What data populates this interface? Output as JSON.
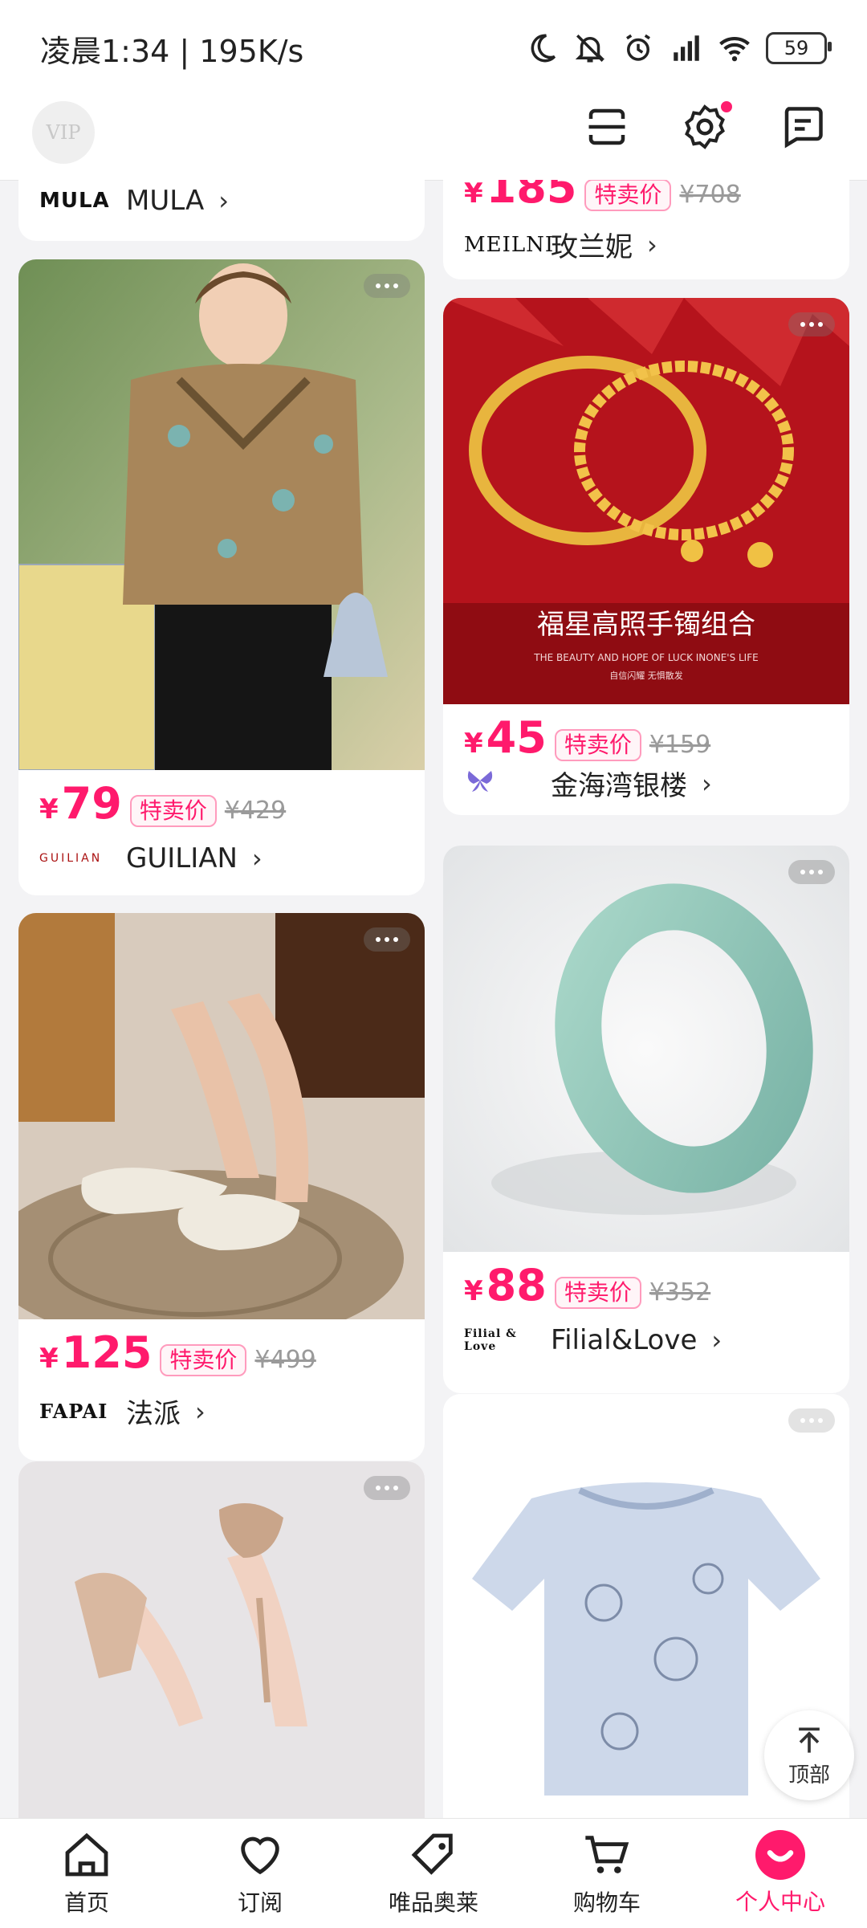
{
  "status": {
    "time": "凌晨1:34 | 195K/s",
    "battery": "59",
    "icons": [
      "moon-icon",
      "mute-bell-icon",
      "alarm-icon",
      "signal-icon",
      "wifi-icon",
      "battery-icon"
    ]
  },
  "topbar": {
    "logo_text": "VIP",
    "icons": [
      "scan-icon",
      "settings-icon",
      "message-icon"
    ]
  },
  "products": {
    "c0": {
      "brand_logo": "MULA",
      "brand": "MULA"
    },
    "c1": {
      "price": "185",
      "tag": "特卖价",
      "orig": "¥708",
      "brand_logo": "MEILNI",
      "brand": "玫兰妮"
    },
    "c2": {
      "price": "79",
      "tag": "特卖价",
      "orig": "¥429",
      "brand_logo": "GUILIAN",
      "brand": "GUILIAN"
    },
    "c3": {
      "price": "45",
      "tag": "特卖价",
      "orig": "¥159",
      "brand": "金海湾银楼",
      "banner_title": "福星高照手镯组合",
      "banner_sub": "THE BEAUTY AND HOPE OF LUCK INONE'S LIFE",
      "banner_sub2": "自信闪耀 无惧散发"
    },
    "c4": {
      "price": "125",
      "tag": "特卖价",
      "orig": "¥499",
      "brand_logo": "FAPAI",
      "brand": "法派"
    },
    "c5": {
      "price": "88",
      "tag": "特卖价",
      "orig": "¥352",
      "brand_logo": "Filial & Love",
      "brand": "Filial&Love"
    }
  },
  "currency": "¥",
  "top_button": "顶部",
  "tabs": [
    {
      "label": "首页"
    },
    {
      "label": "订阅"
    },
    {
      "label": "唯品奥莱"
    },
    {
      "label": "购物车"
    },
    {
      "label": "个人中心"
    }
  ],
  "colors": {
    "accent": "#ff1a6c"
  }
}
